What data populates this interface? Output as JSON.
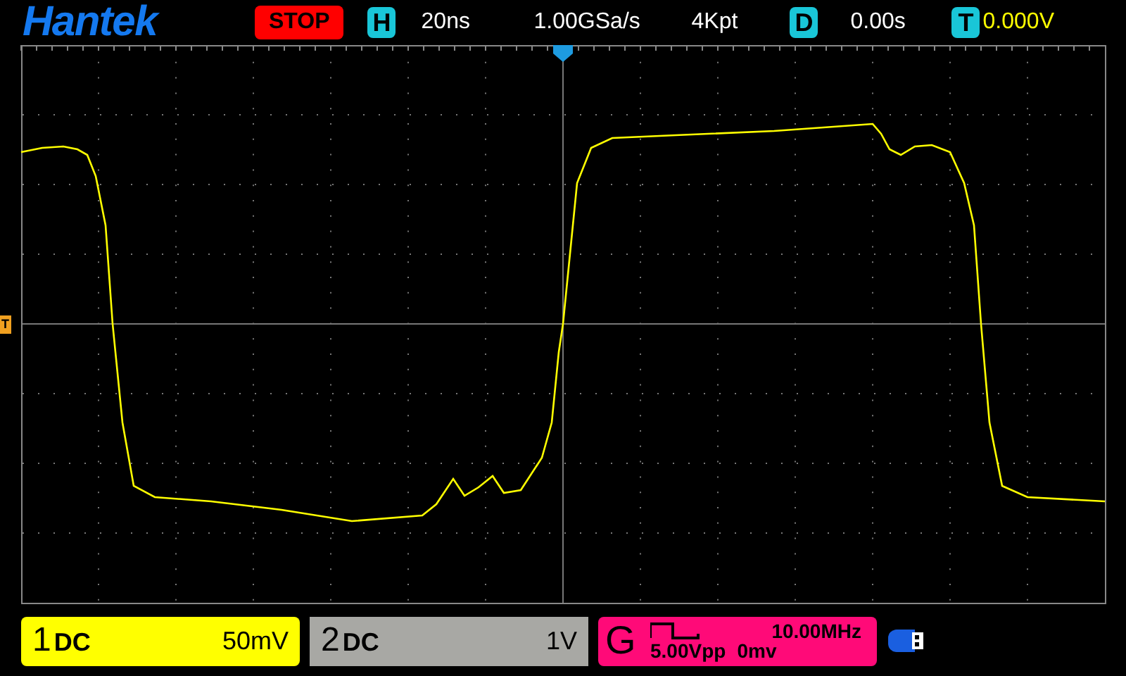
{
  "logo": "Hantek",
  "run_state": "STOP",
  "timebase": {
    "label": "H",
    "value": "20ns"
  },
  "sample_rate": "1.00GSa/s",
  "memory_depth": "4Kpt",
  "delay": {
    "label": "D",
    "value": "0.00s"
  },
  "trigger": {
    "label": "T",
    "level": "0.000V"
  },
  "trigger_level_marker": "T",
  "channels": [
    {
      "number": "1",
      "coupling": "DC",
      "scale": "50mV",
      "color": "#ffff00"
    },
    {
      "number": "2",
      "coupling": "DC",
      "scale": "1V",
      "color": "#a8a8a4"
    }
  ],
  "generator": {
    "label": "G",
    "frequency": "10.00MHz",
    "amplitude": "5.00Vpp",
    "offset": "0mv"
  }
}
